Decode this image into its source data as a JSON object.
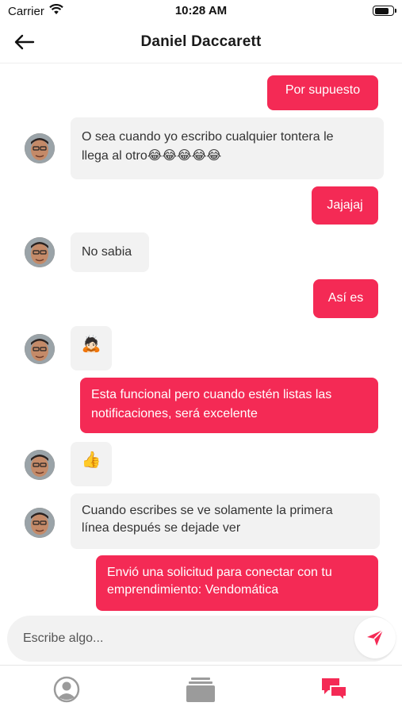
{
  "status_bar": {
    "carrier": "Carrier",
    "time": "10:28 AM",
    "battery_level": 0.85
  },
  "header": {
    "title": "Daniel Daccarett",
    "back_icon": "arrow-left-icon"
  },
  "messages": [
    {
      "direction": "out",
      "text": "Por supuesto"
    },
    {
      "direction": "in",
      "line1": "O sea cuando yo escribo cualquier tontera le",
      "line2": "llega al otro😂😂😂😂😂"
    },
    {
      "direction": "out",
      "text": "Jajajaj"
    },
    {
      "direction": "in",
      "text": "No sabia"
    },
    {
      "direction": "out",
      "text": "Así es"
    },
    {
      "direction": "in",
      "text": "🙇🏻"
    },
    {
      "direction": "out",
      "line1": "Esta funcional pero cuando estén listas las",
      "line2": "notificaciones, será excelente"
    },
    {
      "direction": "in",
      "text": "👍"
    },
    {
      "direction": "in",
      "line1": "Cuando escribes se ve solamente la primera",
      "line2": "línea después se dejade ver"
    },
    {
      "direction": "out",
      "line1": "Envió una solicitud para conectar con tu",
      "line2": "emprendimiento: Vendomática"
    }
  ],
  "composer": {
    "placeholder": "Escribe algo...",
    "value": "",
    "send_icon": "send-icon"
  },
  "tabs": [
    {
      "name": "profile",
      "icon": "user-icon",
      "active": false
    },
    {
      "name": "cards",
      "icon": "cards-icon",
      "active": false
    },
    {
      "name": "messages",
      "icon": "chat-icon",
      "active": true
    }
  ],
  "colors": {
    "accent": "#f42a55",
    "incoming_bubble": "#f2f2f2",
    "tab_inactive": "#9b9b9b"
  }
}
